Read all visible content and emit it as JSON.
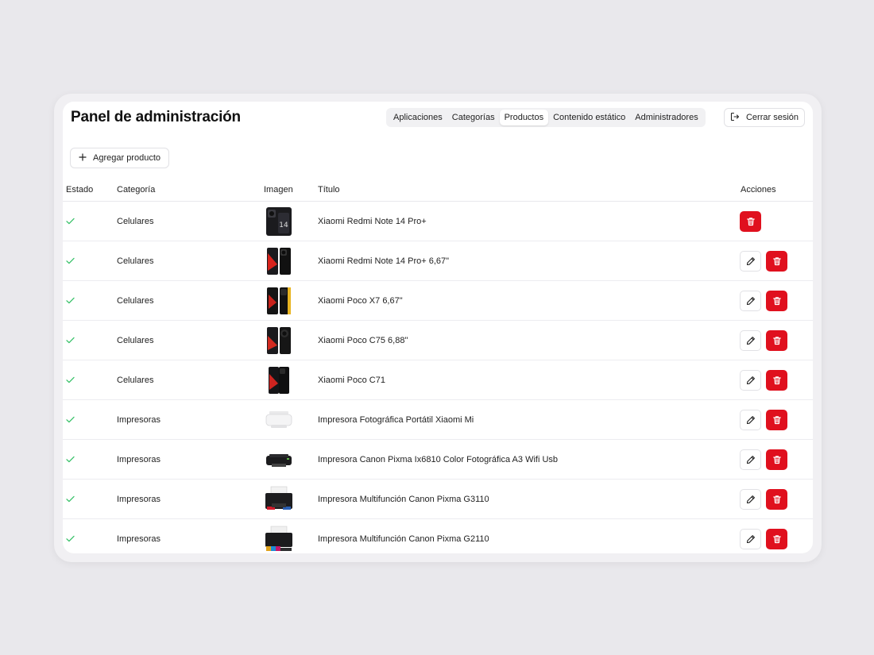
{
  "header": {
    "title": "Panel de administración",
    "tabs": [
      {
        "label": "Aplicaciones",
        "active": false
      },
      {
        "label": "Categorías",
        "active": false
      },
      {
        "label": "Productos",
        "active": true
      },
      {
        "label": "Contenido estático",
        "active": false
      },
      {
        "label": "Administradores",
        "active": false
      }
    ],
    "logout_label": "Cerrar sesión",
    "logout_icon": "logout-icon"
  },
  "toolbar": {
    "add_label": "Agregar producto",
    "add_icon": "plus-icon"
  },
  "table": {
    "columns": {
      "estado": "Estado",
      "categoria": "Categoría",
      "imagen": "Imagen",
      "titulo": "Título",
      "acciones": "Acciones"
    },
    "rows": [
      {
        "estado": "check-icon",
        "categoria": "Celulares",
        "imagen": "phone-image",
        "titulo": "Xiaomi Redmi Note 14 Pro+",
        "actions": [
          "delete"
        ]
      },
      {
        "estado": "check-icon",
        "categoria": "Celulares",
        "imagen": "phone-image",
        "titulo": "Xiaomi Redmi Note 14 Pro+ 6,67\"",
        "actions": [
          "edit",
          "delete"
        ]
      },
      {
        "estado": "check-icon",
        "categoria": "Celulares",
        "imagen": "phone-image",
        "titulo": "Xiaomi Poco X7 6,67\"",
        "actions": [
          "edit",
          "delete"
        ]
      },
      {
        "estado": "check-icon",
        "categoria": "Celulares",
        "imagen": "phone-image",
        "titulo": "Xiaomi Poco C75 6,88\"",
        "actions": [
          "edit",
          "delete"
        ]
      },
      {
        "estado": "check-icon",
        "categoria": "Celulares",
        "imagen": "phone-image",
        "titulo": "Xiaomi Poco C71",
        "actions": [
          "edit",
          "delete"
        ]
      },
      {
        "estado": "check-icon",
        "categoria": "Impresoras",
        "imagen": "printer-image",
        "titulo": "Impresora Fotográfica Portátil Xiaomi Mi",
        "actions": [
          "edit",
          "delete"
        ]
      },
      {
        "estado": "check-icon",
        "categoria": "Impresoras",
        "imagen": "printer-image",
        "titulo": "Impresora Canon Pixma Ix6810 Color Fotográfica A3 Wifi Usb",
        "actions": [
          "edit",
          "delete"
        ]
      },
      {
        "estado": "check-icon",
        "categoria": "Impresoras",
        "imagen": "printer-image",
        "titulo": "Impresora Multifunción Canon Pixma G3110",
        "actions": [
          "edit",
          "delete"
        ]
      },
      {
        "estado": "check-icon",
        "categoria": "Impresoras",
        "imagen": "printer-image",
        "titulo": "Impresora Multifunción Canon Pixma G2110",
        "actions": [
          "edit",
          "delete"
        ]
      }
    ]
  },
  "colors": {
    "background": "#e9e8ec",
    "panel": "#ffffff",
    "delete": "#e0101e",
    "check": "#3ac26a"
  }
}
